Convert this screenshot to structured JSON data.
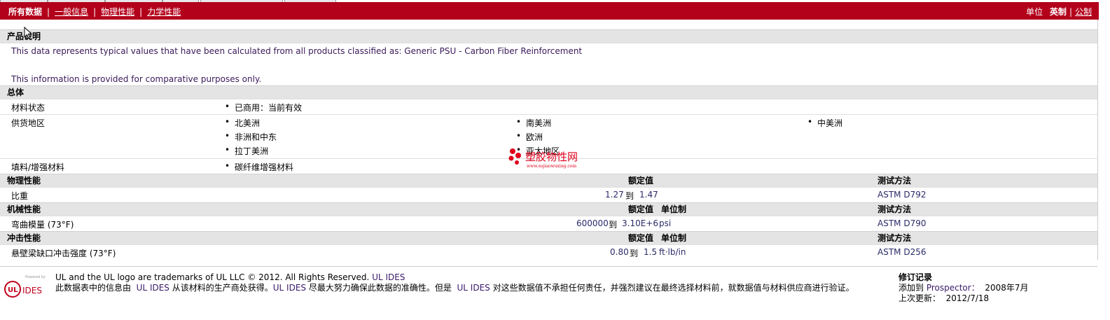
{
  "nav": {
    "tabs": [
      "所有数据",
      "一般信息",
      "物理性能",
      "力学性能"
    ],
    "units_label": "单位",
    "unit_imperial": "英制",
    "unit_metric": "公制"
  },
  "product": {
    "header": "产品说明",
    "line1": "This data represents typical values that have been calculated from all products classified as: Generic PSU - Carbon Fiber Reinforcement",
    "line2": "This information is provided for comparative purposes only."
  },
  "general": {
    "header": "总体",
    "material_status_label": "材料状态",
    "material_status_value": "已商用：当前有效",
    "supply_label": "供货地区",
    "regions": [
      "北美洲",
      "南美洲",
      "中美洲",
      "非洲和中东",
      "欧洲",
      "拉丁美洲",
      "亚太地区"
    ],
    "filler_label": "填料/增强材料",
    "filler_value": "碳纤维增强材料"
  },
  "physical": {
    "header": "物理性能",
    "col_nominal": "额定值",
    "col_method": "测试方法",
    "rows": [
      {
        "name": "比重",
        "from": "1.27",
        "to_word": "到",
        "to": "1.47",
        "unit": "",
        "method": "ASTM D792"
      }
    ]
  },
  "mechanical": {
    "header": "机械性能",
    "col_nominal": "额定值",
    "col_unit": "单位制",
    "col_method": "测试方法",
    "rows": [
      {
        "name": "弯曲模量",
        "cond": "(73°F)",
        "from": "600000",
        "to_word": "到",
        "to": "3.10E+6",
        "unit": "psi",
        "method": "ASTM D790"
      }
    ]
  },
  "impact": {
    "header": "冲击性能",
    "col_nominal": "额定值",
    "col_unit": "单位制",
    "col_method": "测试方法",
    "rows": [
      {
        "name": "悬壁梁缺口冲击强度",
        "cond": "(73°F)",
        "from": "0.80",
        "to_word": "到",
        "to": "1.5",
        "unit": "ft·lb/in",
        "method": "ASTM D256"
      }
    ]
  },
  "footer": {
    "logo_powered": "Powered by",
    "logo_ul": "UL",
    "logo_ides": "IDES",
    "line1_prefix": "UL and the UL logo are trademarks of UL LLC © 2012. All Rights Reserved.",
    "link_ul_ides": "UL IDES",
    "line2_a": "此数据表中的信息由",
    "line2_b": "从该材料的生产商处获得。",
    "line2_c": "尽最大努力确保此数据的准确性。但是",
    "line2_d": "对这些数据值不承担任何责任，并强烈建议在最终选择材料前，就数据值与材料供应商进行验证。",
    "revision_header": "修订记录",
    "added_label": "添加到",
    "added_site": "Prospector：",
    "added_date": "2008年7月",
    "updated_label": "上次更新：",
    "updated_date": "2012/7/18"
  },
  "watermark": {
    "cn": "塑胶物性网",
    "url": "www.sujiaowuxing.com",
    "color": "#e0001b"
  },
  "colors": {
    "navbar": "#b3001b",
    "header_bg": "#e4e4e4",
    "link": "#3a1a6a"
  }
}
